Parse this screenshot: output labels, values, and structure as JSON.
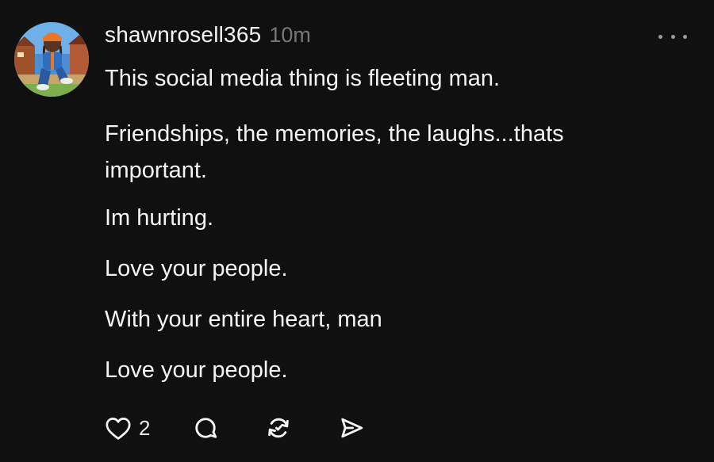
{
  "post": {
    "username": "shawnrosell365",
    "timestamp": "10m",
    "paragraphs": [
      "This social media thing is fleeting man.",
      "Friendships, the memories, the laughs...thats important.",
      "Im hurting.",
      "Love your people.",
      "With your entire heart, man",
      "Love your people."
    ],
    "actions": {
      "like_count": "2",
      "icons": [
        "heart-icon",
        "comment-icon",
        "repost-icon",
        "share-icon"
      ]
    }
  },
  "colors": {
    "background": "#101010",
    "text": "#f3f5f7",
    "muted": "#777777"
  }
}
